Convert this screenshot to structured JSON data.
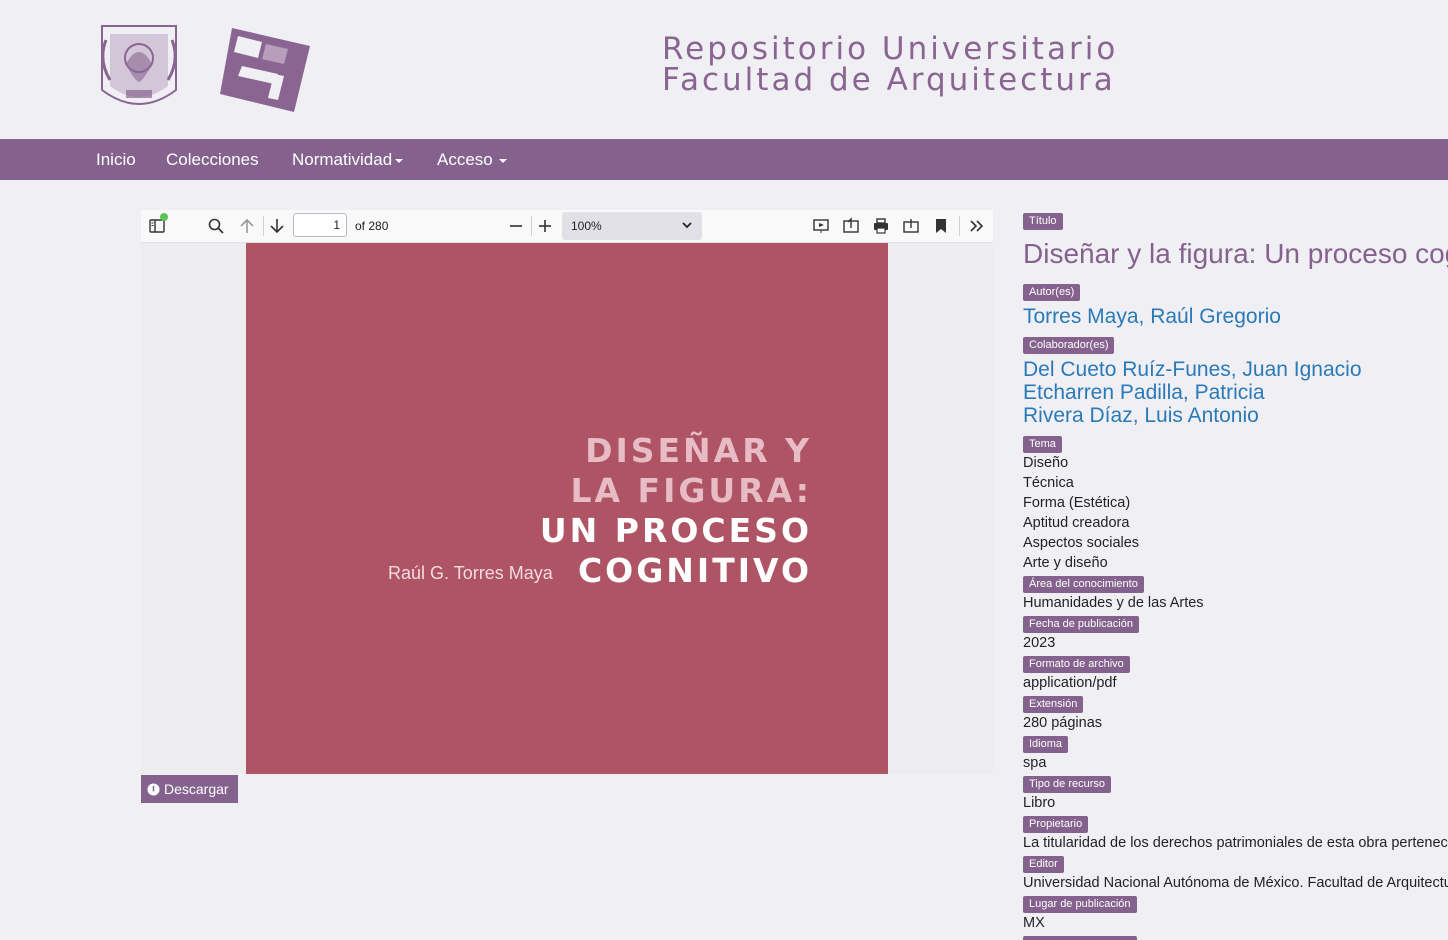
{
  "header": {
    "title_line1": "Repositorio Universitario",
    "title_line2": "Facultad de Arquitectura",
    "logo_unam_icon": "unam-crest-icon",
    "logo_fa_icon": "facultad-arquitectura-logo-icon"
  },
  "nav": {
    "items": [
      "Inicio",
      "Colecciones",
      "Normatividad",
      "Acceso"
    ]
  },
  "viewer": {
    "page_number": "1",
    "page_total": "of 280",
    "zoom": "100%",
    "cover": {
      "line1": "DISEÑAR Y",
      "line2": "LA FIGURA:",
      "line3": "UN PROCESO",
      "line4": "COGNITIVO",
      "author": "Raúl G. Torres Maya"
    },
    "download_label": "Descargar"
  },
  "metadata": {
    "titulo_label": "Título",
    "titulo": "Diseñar y la figura: Un proceso cognitivo",
    "autores_label": "Autor(es)",
    "autores": [
      "Torres Maya, Raúl Gregorio"
    ],
    "colaboradores_label": "Colaborador(es)",
    "colaboradores": [
      "Del Cueto Ruíz-Funes, Juan Ignacio",
      "Etcharren Padilla, Patricia",
      "Rivera Díaz, Luis Antonio"
    ],
    "tema_label": "Tema",
    "temas": [
      "Diseño",
      "Técnica",
      "Forma (Estética)",
      "Aptitud creadora",
      "Aspectos sociales",
      "Arte y diseño"
    ],
    "area_label": "Área del conocimiento",
    "area": "Humanidades y de las Artes",
    "fecha_label": "Fecha de publicación",
    "fecha": "2023",
    "formato_label": "Formato de archivo",
    "formato": "application/pdf",
    "extension_label": "Extensión",
    "extension": "280 páginas",
    "idioma_label": "Idioma",
    "idioma": "spa",
    "tipo_label": "Tipo de recurso",
    "tipo": "Libro",
    "propietario_label": "Propietario",
    "propietario": "La titularidad de los derechos patrimoniales de esta obra pertenece",
    "editor_label": "Editor",
    "editor": "Universidad Nacional Autónoma de México. Facultad de Arquitectura",
    "lugar_label": "Lugar de publicación",
    "lugar": "MX"
  },
  "colors": {
    "brand": "#85628e",
    "link": "#2a7ab8",
    "cover": "#ae5465",
    "background": "#f0eff4"
  }
}
